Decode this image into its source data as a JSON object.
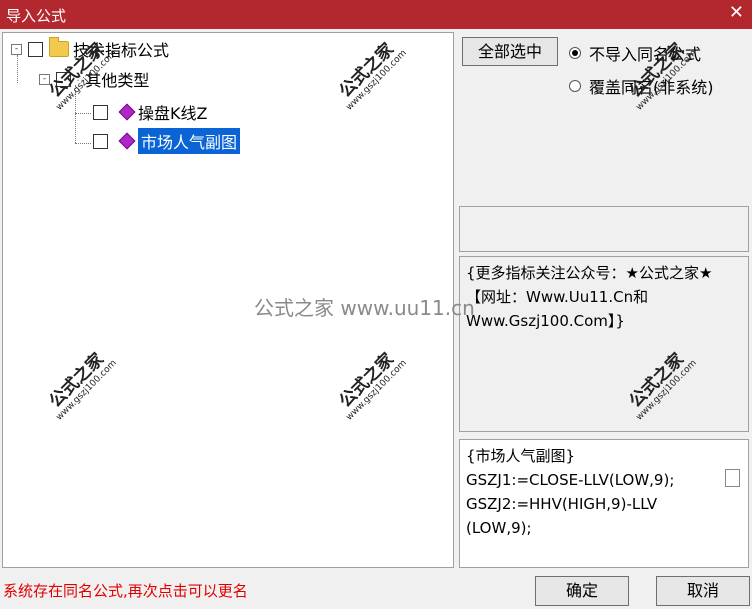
{
  "window": {
    "title": "导入公式",
    "close": "✕"
  },
  "tree": {
    "root": {
      "expander": "-",
      "label": "技术指标公式"
    },
    "group": {
      "expander": "-",
      "label": "其他类型"
    },
    "items": [
      {
        "label": "操盘K线Z",
        "selected": false
      },
      {
        "label": "市场人气副图",
        "selected": true
      }
    ]
  },
  "controls": {
    "select_all": "全部选中",
    "radio_skip": "不导入同名公式",
    "radio_overwrite": "覆盖同名(非系统)",
    "selected_radio": "radio_skip"
  },
  "description": "{更多指标关注公众号：★公式之家★ 【网址：Www.Uu11.Cn和Www.Gszj100.Com】}",
  "code": {
    "lines": [
      "{市场人气副图}",
      "GSZJ1:=CLOSE-LLV(LOW,9);",
      "GSZJ2:=HHV(HIGH,9)-LLV",
      "(LOW,9);"
    ]
  },
  "status_text": "系统存在同名公式,再次点击可以更名",
  "buttons": {
    "ok": "确定",
    "cancel": "取消"
  },
  "watermark": {
    "brand": "公式之家",
    "url": "www.gszj100.com",
    "center": "公式之家 www.uu11.cn"
  }
}
